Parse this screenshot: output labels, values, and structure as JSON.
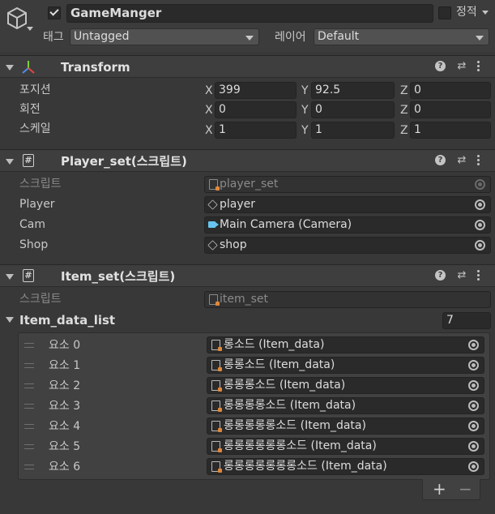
{
  "header": {
    "object_name": "GameManger",
    "active": true,
    "static_label": "정적",
    "tag_label": "태그",
    "tag_value": "Untagged",
    "layer_label": "레이어",
    "layer_value": "Default"
  },
  "transform": {
    "title": "Transform",
    "rows": [
      {
        "label": "포지션",
        "x": "399",
        "y": "92.5",
        "z": "0"
      },
      {
        "label": "회전",
        "x": "0",
        "y": "0",
        "z": "0"
      },
      {
        "label": "스케일",
        "x": "1",
        "y": "1",
        "z": "1"
      }
    ],
    "axes": [
      "X",
      "Y",
      "Z"
    ]
  },
  "player_set": {
    "title": "Player_set(스크립트)",
    "script_label": "스크립트",
    "script_value": "player_set",
    "fields": [
      {
        "label": "Player",
        "value": "player",
        "icon": "gameobject-icon"
      },
      {
        "label": "Cam",
        "value": "Main Camera (Camera)",
        "icon": "camera-icon"
      },
      {
        "label": "Shop",
        "value": "shop",
        "icon": "gameobject-icon"
      }
    ]
  },
  "item_set": {
    "title": "Item_set(스크립트)",
    "script_label": "스크립트",
    "script_value": "item_set",
    "list_label": "Item_data_list",
    "list_size": "7",
    "elements": [
      {
        "label": "요소 0",
        "value": "롱소드 (Item_data)"
      },
      {
        "label": "요소 1",
        "value": "롱롱소드 (Item_data)"
      },
      {
        "label": "요소 2",
        "value": "롱롱롱소드 (Item_data)"
      },
      {
        "label": "요소 3",
        "value": "롱롱롱롱소드 (Item_data)"
      },
      {
        "label": "요소 4",
        "value": "롱롱롱롱롱소드 (Item_data)"
      },
      {
        "label": "요소 5",
        "value": "롱롱롱롱롱롱소드 (Item_data)"
      },
      {
        "label": "요소 6",
        "value": "롱롱롱롱롱롱롱소드 (Item_data)"
      }
    ],
    "add_symbol": "+",
    "remove_symbol": "−"
  },
  "icons": {
    "help": "?",
    "script_glyph": "#"
  },
  "colors": {
    "background": "#383838",
    "field": "#2a2a2a",
    "camera_accent": "#66c3f0",
    "scriptable_object_accent": "#e0873a"
  }
}
